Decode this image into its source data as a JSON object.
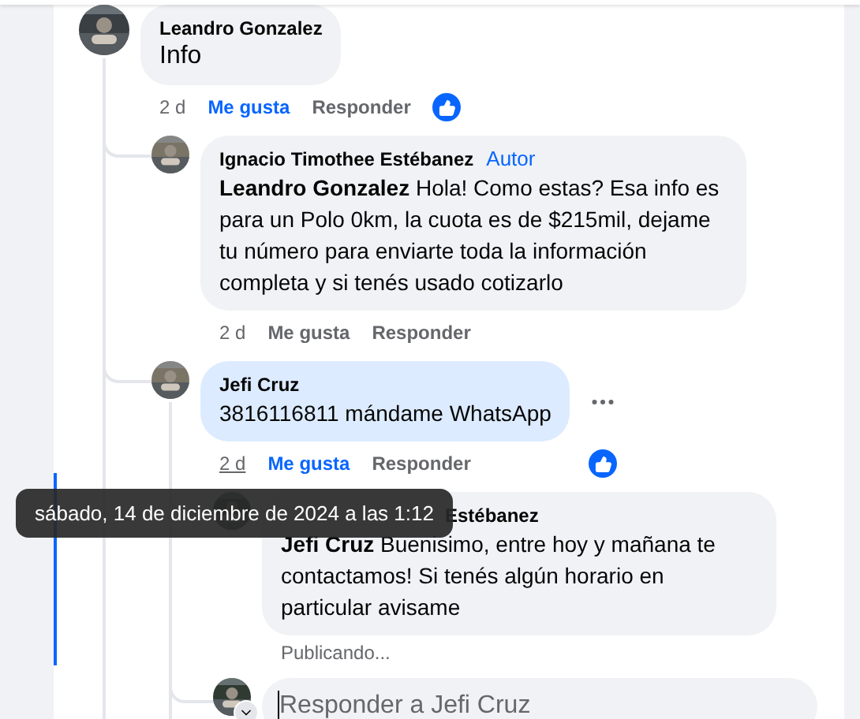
{
  "comments": [
    {
      "author": "Leandro Gonzalez",
      "text": "Info",
      "time": "2 d",
      "like_label": "Me gusta",
      "liked": true,
      "reply_label": "Responder",
      "has_reaction": true,
      "highlighted": false,
      "menu_visible": false,
      "time_hovered": false,
      "children": [
        {
          "author": "Ignacio Timothee Estébanez",
          "badge": "Autor",
          "text": "**Leandro Gonzalez** Hola! Como estas? Esa info es para un Polo 0km, la cuota es de $215mil, dejame tu número para enviarte toda la información completa y si tenés usado cotizarlo",
          "time": "2 d",
          "like_label": "Me gusta",
          "liked": false,
          "reply_label": "Responder",
          "has_reaction": false,
          "highlighted": false,
          "menu_visible": false,
          "time_hovered": false
        },
        {
          "author": "Jefi Cruz",
          "text": "3816116811 mándame WhatsApp",
          "time": "2 d",
          "like_label": "Me gusta",
          "liked": true,
          "reply_label": "Responder",
          "has_reaction": true,
          "highlighted": true,
          "menu_visible": true,
          "time_hovered": true,
          "children": [
            {
              "author": "Estébanez",
              "covered": true,
              "text": "**Jefi Cruz** Buenisimo, entre hoy y mañana te contactamos! Si tenés algún horario en particular avisame",
              "status": "Publicando...",
              "highlighted": false,
              "menu_visible": false
            }
          ],
          "reply_field": {
            "placeholder": "Responder a Jefi Cruz",
            "focused": true
          }
        }
      ]
    }
  ],
  "tooltip": {
    "text": "sábado, 14 de diciembre de 2024 a las 1:12"
  }
}
